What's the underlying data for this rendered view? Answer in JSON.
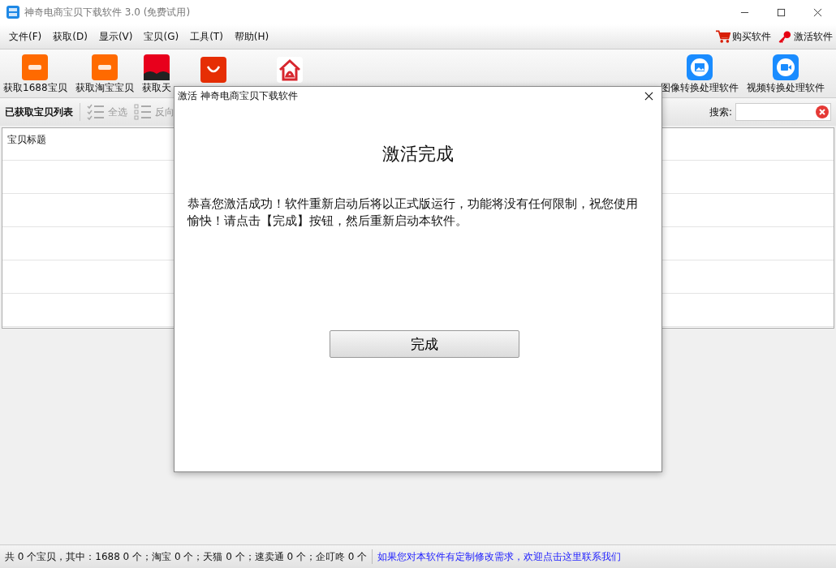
{
  "window": {
    "title": "神奇电商宝贝下载软件 3.0 (免费试用)"
  },
  "menu": [
    "文件(F)",
    "获取(D)",
    "显示(V)",
    "宝贝(G)",
    "工具(T)",
    "帮助(H)"
  ],
  "menu_actions": [
    {
      "kind": "cart",
      "label": "购买软件"
    },
    {
      "kind": "key",
      "label": "激活软件"
    }
  ],
  "toolbar": [
    {
      "kind": "alibaba",
      "label": "获取1688宝贝"
    },
    {
      "kind": "taobao",
      "label": "获取淘宝宝贝"
    },
    {
      "kind": "tmall",
      "label": "获取天"
    },
    {
      "kind": "aliexpress"
    },
    {
      "kind": "house"
    }
  ],
  "toolbar_right": [
    {
      "kind": "image",
      "label": "图像转换处理软件"
    },
    {
      "kind": "video",
      "label": "视频转换处理软件"
    }
  ],
  "list_bar": {
    "title": "已获取宝贝列表",
    "actions": [
      {
        "kind": "checklist",
        "label": "全选"
      },
      {
        "kind": "list",
        "label": "反向"
      }
    ],
    "search_label": "搜索:"
  },
  "table": {
    "columns": [
      "宝贝标题"
    ]
  },
  "status_bar": {
    "summary": "共 0 个宝贝，其中：1688 0 个；淘宝 0 个；天猫 0 个；速卖通 0 个；企叮咚 0 个",
    "link": "如果您对本软件有定制修改需求，欢迎点击这里联系我们"
  },
  "dialog": {
    "title": "激活 神奇电商宝贝下载软件",
    "heading": "激活完成",
    "message": "恭喜您激活成功！软件重新启动后将以正式版运行，功能将没有任何限制，祝您使用愉快！请点击【完成】按钮，然后重新启动本软件。",
    "button": "完成"
  }
}
